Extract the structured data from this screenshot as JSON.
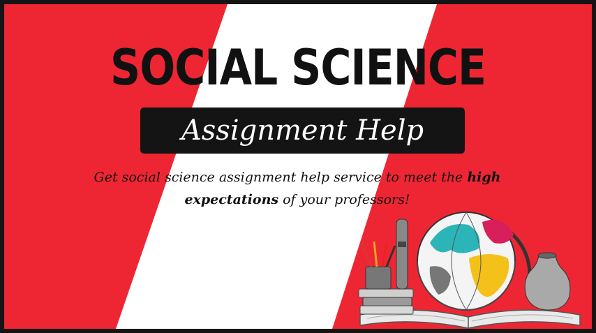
{
  "banner": {
    "title": "SOCIAL SCIENCE",
    "subtitle": "Assignment Help",
    "tagline": {
      "part1": "Get social science assignment help service to meet the ",
      "bold1": "high",
      "bold2": "expectations",
      "part2": " of your professors!"
    },
    "illustration_icons": [
      "globe-icon",
      "books-icon",
      "pencil-cup-icon",
      "open-book-icon",
      "vase-icon",
      "rolled-scroll-icon"
    ]
  },
  "colors": {
    "background_red": "#ee2633",
    "stripe_white": "#ffffff",
    "text_dark": "#141414"
  }
}
